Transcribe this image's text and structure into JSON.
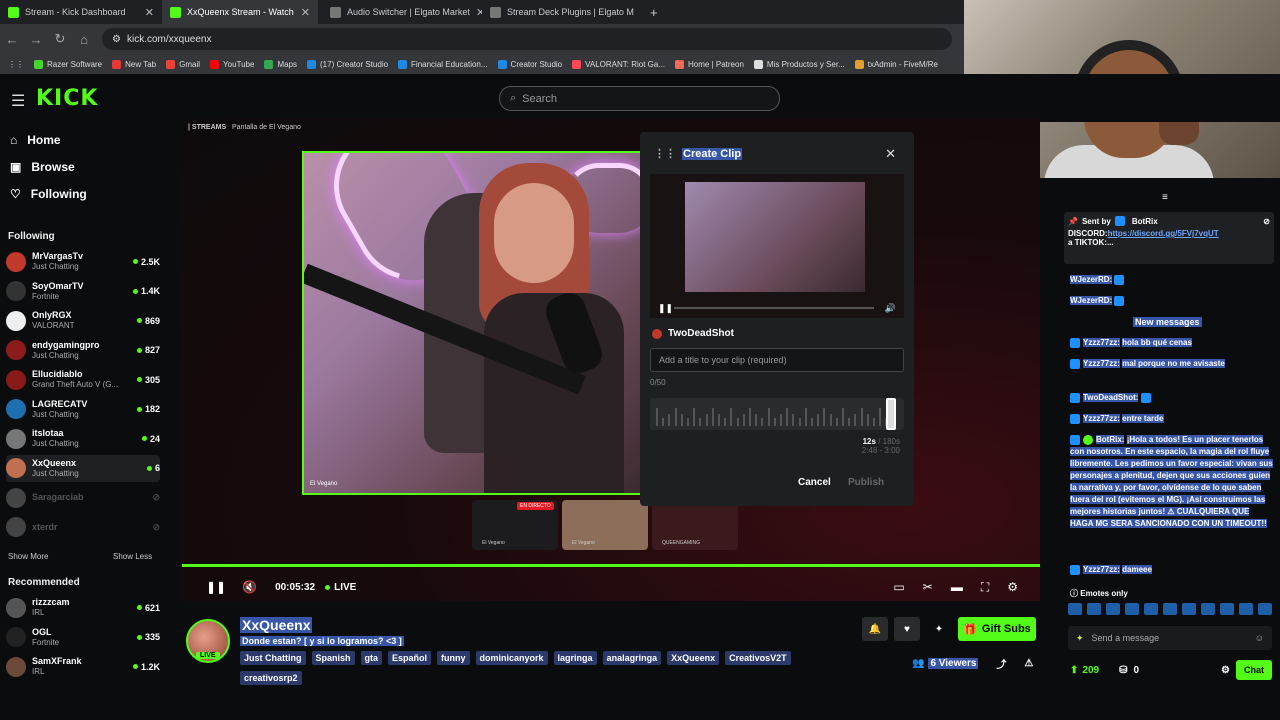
{
  "browser": {
    "tabs": [
      {
        "title": "Stream - Kick Dashboard",
        "color": "#53fc18"
      },
      {
        "title": "XxQueenx Stream - Watch",
        "color": "#53fc18"
      },
      {
        "title": "Audio Switcher | Elgato Market",
        "color": "#bbbbbb"
      },
      {
        "title": "Stream Deck Plugins | Elgato M",
        "color": "#bbbbbb"
      }
    ],
    "new_tab": "+",
    "url": "kick.com/xxqueenx",
    "bookmarks": [
      "Razer Software",
      "New Tab",
      "Gmail",
      "YouTube",
      "Maps",
      "(17) Creator Studio",
      "Financial Education...",
      "Creator Studio",
      "VALORANT: Riot Ga...",
      "Home | Patreon",
      "Mis Productos y Ser...",
      "txAdmin - FiveM/Re"
    ]
  },
  "header": {
    "logo": "KICK",
    "search_placeholder": "Search"
  },
  "sidebar": {
    "home": "Home",
    "browse": "Browse",
    "following": "Following",
    "following_header": "Following",
    "channels": [
      {
        "name": "MrVargasTv",
        "game": "Just Chatting",
        "viewers": "2.5K",
        "color": "#c0392b"
      },
      {
        "name": "SoyOmarTV",
        "game": "Fortnite",
        "viewers": "1.4K",
        "color": "#333333"
      },
      {
        "name": "OnlyRGX",
        "game": "VALORANT",
        "viewers": "869",
        "color": "#eeeeee"
      },
      {
        "name": "endygamingpro",
        "game": "Just Chatting",
        "viewers": "827",
        "color": "#8e1b1b"
      },
      {
        "name": "Ellucidiablo",
        "game": "Grand Theft Auto V (G...",
        "viewers": "305",
        "color": "#8a1a1a"
      },
      {
        "name": "LAGRECATV",
        "game": "Just Chatting",
        "viewers": "182",
        "color": "#1e6fb0"
      },
      {
        "name": "itslotaa",
        "game": "Just Chatting",
        "viewers": "24",
        "color": "#777777"
      },
      {
        "name": "XxQueenx",
        "game": "Just Chatting",
        "viewers": "6",
        "color": "#c07050"
      },
      {
        "name": "Saragarciab",
        "game": "",
        "viewers": "",
        "color": "#444444"
      },
      {
        "name": "xterdr",
        "game": "",
        "viewers": "",
        "color": "#444444"
      }
    ],
    "show_more": "Show More",
    "show_less": "Show Less",
    "recommended_header": "Recommended",
    "recommended": [
      {
        "name": "rizzzcam",
        "game": "IRL",
        "viewers": "621",
        "color": "#555555"
      },
      {
        "name": "OGL",
        "game": "Fortnite",
        "viewers": "335",
        "color": "#222222"
      },
      {
        "name": "SamXFrank",
        "game": "IRL",
        "viewers": "1.2K",
        "color": "#6b4a3a"
      }
    ]
  },
  "player": {
    "top_label": "| STREAMS",
    "top_sub": "Pantalla de El Vegano",
    "inner_tag": "El Vegano",
    "thumb_labels": [
      "El Vegano",
      "El Vegano",
      "QUEENGAMING"
    ],
    "en_directo": "EN DIRECTO",
    "time": "00:05:32",
    "live": "LIVE"
  },
  "clip_modal": {
    "title": "Create Clip",
    "channel": "TwoDeadShot",
    "title_placeholder": "Add a title to your clip (required)",
    "counter": "0/50",
    "duration": "12s",
    "duration_max": "/ 180s",
    "range": "2:48 - 3:00",
    "cancel": "Cancel",
    "publish": "Publish"
  },
  "stream_info": {
    "streamer": "XxQueenx",
    "live": "LIVE",
    "title": "Donde estan? [ y si lo logramos? <3 ]",
    "tags": [
      "Just Chatting",
      "Spanish",
      "gta",
      "Español",
      "funny",
      "dominicanyork",
      "lagringa",
      "analagringa",
      "XxQueenx",
      "CreativosV2T",
      "creativosrp2"
    ],
    "gift_subs": "Gift Subs",
    "viewers": "6 Viewers"
  },
  "chat": {
    "pinned_sent_by": "Sent by",
    "pinned_user": "BotRix",
    "pinned_discord_label": "DISCORD:",
    "pinned_discord_link": "https://discord.gg/5FVj7vqUT",
    "pinned_more": "a TIKTOK:...",
    "messages": [
      {
        "user": "WJezerRD:",
        "text": ""
      },
      {
        "user": "WJezerRD:",
        "text": ""
      }
    ],
    "new_messages": "New messages",
    "messages2": [
      {
        "user": "Yzzz77zz:",
        "text": "hola bb qué cenas"
      },
      {
        "user": "Yzzz77zz:",
        "text": "mal porque no me avisaste"
      },
      {
        "user": "TwoDeadShot:",
        "text": ""
      },
      {
        "user": "Yzzz77zz:",
        "text": "entre tarde"
      },
      {
        "user": "BotRix:",
        "text": "¡Hola a todos! Es un placer tenerlos con nosotros. En este espacio, la magia del rol fluye libremente. Les pedimos un favor especial: vivan sus personajes a plenitud, dejen que sus acciones guíen la narrativa y, por favor, olvídense de lo que saben fuera del rol (evitemos el MG). ¡Así construimos las mejores historias juntos! ⚠ CUALQUIERA QUE HAGA MG SERA SANCIONADO CON UN TIMEOUT!!"
      },
      {
        "user": "Yzzz77zz:",
        "text": "dameee"
      }
    ],
    "emotes_only": "Emotes only",
    "input_placeholder": "Send a message",
    "points": "209",
    "count": "0",
    "chat_button": "Chat"
  }
}
